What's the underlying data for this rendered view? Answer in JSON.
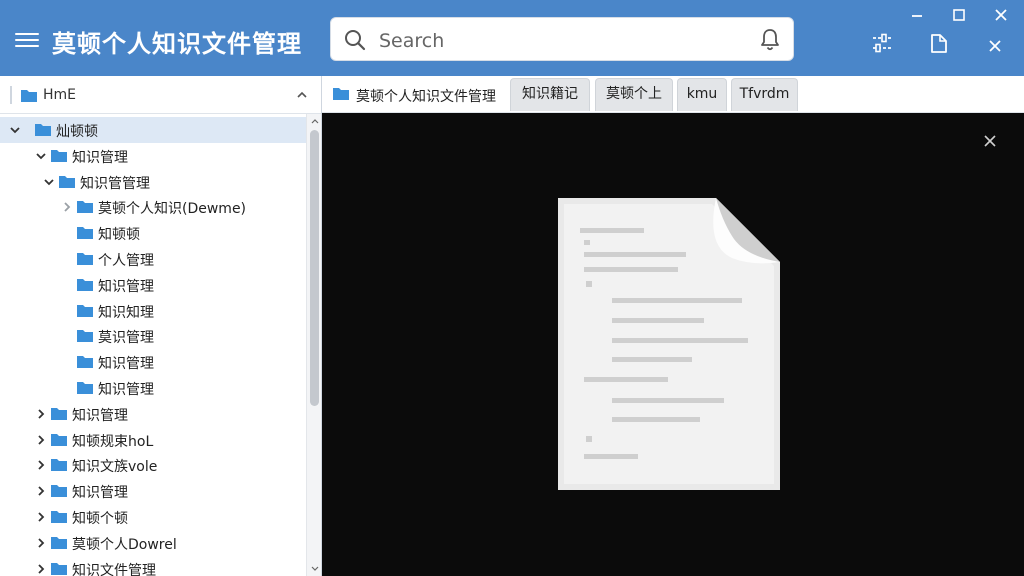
{
  "app": {
    "title": "莫顿个人知识文件管理",
    "menu_icon": "hamburger-icon"
  },
  "search": {
    "placeholder": "Search",
    "value": "",
    "icon": "search-icon",
    "notify_icon": "bell-icon"
  },
  "toolbar": {
    "icons": [
      "settings-sliders-icon",
      "clipboard-icon"
    ]
  },
  "window": {
    "controls": [
      "minimize-icon",
      "maximize-icon",
      "close-icon"
    ]
  },
  "sidebar": {
    "header_label": "HmE",
    "tree": [
      {
        "label": "灿顿顿",
        "level": 0,
        "state": "expanded",
        "selected": true
      },
      {
        "label": "知识管理",
        "level": 1,
        "state": "expanded"
      },
      {
        "label": "知识管管理",
        "level": 2,
        "state": "expanded"
      },
      {
        "label": "莫顿个人知识(Dewme)",
        "level": 3,
        "state": "collapsed-light"
      },
      {
        "label": "知顿顿",
        "level": 3,
        "state": "none"
      },
      {
        "label": "个人管理",
        "level": 3,
        "state": "none"
      },
      {
        "label": "知识管理",
        "level": 3,
        "state": "none"
      },
      {
        "label": "知识知理",
        "level": 3,
        "state": "none"
      },
      {
        "label": "莫识管理",
        "level": 3,
        "state": "none"
      },
      {
        "label": "知识管理",
        "level": 3,
        "state": "none"
      },
      {
        "label": "知识管理",
        "level": 3,
        "state": "none"
      },
      {
        "label": "知识管理",
        "level": 1,
        "state": "collapsed"
      },
      {
        "label": "知顿规束hoL",
        "level": 1,
        "state": "collapsed"
      },
      {
        "label": "知识文族vole",
        "level": 1,
        "state": "collapsed"
      },
      {
        "label": "知识管理",
        "level": 1,
        "state": "collapsed"
      },
      {
        "label": "知顿个顿",
        "level": 1,
        "state": "collapsed"
      },
      {
        "label": "莫顿个人Dowrel",
        "level": 1,
        "state": "collapsed"
      },
      {
        "label": "知识文件管理",
        "level": 1,
        "state": "collapsed"
      }
    ]
  },
  "breadcrumb": {
    "label": "莫顿个人知识文件管理",
    "icon": "folder-icon"
  },
  "tabs": [
    {
      "label": "知识籍记"
    },
    {
      "label": "莫顿个上"
    },
    {
      "label": "kmu"
    },
    {
      "label": "Tfvrdm"
    }
  ],
  "viewer": {
    "close_icon": "close-icon",
    "preview_icon": "document-icon"
  },
  "colors": {
    "titlebar": "#4a86c9",
    "folder": "#3a8fd9",
    "selected_row": "#dde8f5",
    "viewer_bg": "#0b0b0b"
  }
}
